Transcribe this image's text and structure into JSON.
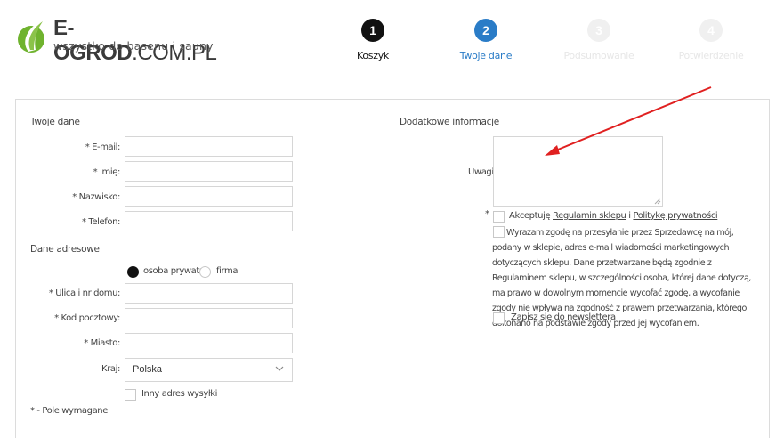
{
  "header": {
    "logo_title_bold": "E-OGROD",
    "logo_title_rest": ".COM.PL",
    "logo_subtitle": "wszystko do basenu i sauny",
    "steps": [
      {
        "number": "1",
        "label": "Koszyk",
        "state": "done"
      },
      {
        "number": "2",
        "label": "Twoje dane",
        "state": "active"
      },
      {
        "number": "3",
        "label": "Podsumowanie",
        "state": "future"
      },
      {
        "number": "4",
        "label": "Potwierdzenie",
        "state": "future"
      }
    ]
  },
  "personal": {
    "heading": "Twoje dane",
    "email_label": "* E-mail:",
    "firstname_label": "* Imię:",
    "lastname_label": "* Nazwisko:",
    "phone_label": "* Telefon:"
  },
  "address": {
    "heading": "Dane adresowe",
    "type_private": "osoba prywatna",
    "type_company": "firma",
    "street_label": "* Ulica i nr domu:",
    "postcode_label": "* Kod pocztowy:",
    "city_label": "* Miasto:",
    "country_label": "Kraj:",
    "country_value": "Polska",
    "other_address_label": "Inny adres wysyłki",
    "required_note": "* - Pole wymagane"
  },
  "extra": {
    "heading": "Dodatkowe informacje",
    "notes_label": "Uwagi",
    "required_star": "*",
    "accept_prefix": "Akceptuję ",
    "terms_link": "Regulamin sklepu",
    "accept_middle": " i ",
    "privacy_link": "Politykę prywatności",
    "consent_text": "Wyrażam zgodę na przesyłanie przez Sprzedawcę na mój, podany w sklepie, adres e-mail wiadomości marketingowych dotyczących sklepu. Dane przetwarzane będą zgodnie z Regulaminem sklepu, w szczególności osoba, której dane dotyczą, ma prawo w dowolnym momencie wycofać zgodę, a wycofanie zgody nie wpływa na zgodność z prawem przetwarzania, którego dokonano na podstawie zgody przed jej wycofaniem.",
    "newsletter_label": "Zapisz się do newslettera"
  },
  "colors": {
    "accent": "#2a7cc7",
    "logo_green": "#6fb32e",
    "annotation_arrow": "#e02020"
  }
}
